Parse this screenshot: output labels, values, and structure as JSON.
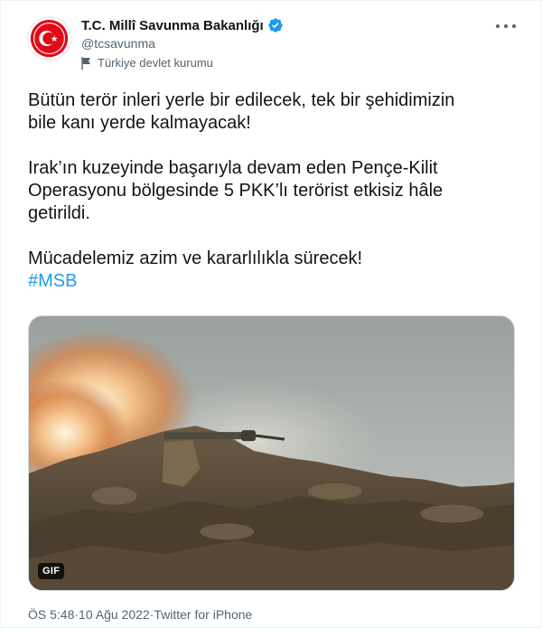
{
  "author": {
    "name": "T.C. Millî Savunma Bakanlığı",
    "handle": "@tcsavunma",
    "label": "Türkiye devlet kurumu"
  },
  "tweet": {
    "lines_p1": [
      "Bütün terör inleri yerle bir edilecek, tek bir şehidimizin",
      "bile kanı yerde kalmayacak!"
    ],
    "lines_p2": [
      "Irak’ın kuzeyinde başarıyla devam eden Pençe-Kilit",
      "Operasyonu bölgesinde 5 PKK’lı terörist etkisiz hâle",
      "getirildi."
    ],
    "lines_p3": [
      "Mücadelemiz azim ve kararlılıkla sürecek!"
    ],
    "hashtag": "#MSB"
  },
  "media": {
    "badge": "GIF"
  },
  "meta": {
    "time": "ÖS 5:48",
    "separator": " · ",
    "date": "10 Ağu 2022",
    "source": "Twitter for iPhone"
  },
  "colors": {
    "accent": "#1d9bf0",
    "text": "#0f1419",
    "secondary": "#536471",
    "logo_red": "#e30a17"
  },
  "icons": {
    "verified": "verified-badge-icon",
    "label": "government-flag-icon",
    "more": "more-options-icon"
  }
}
